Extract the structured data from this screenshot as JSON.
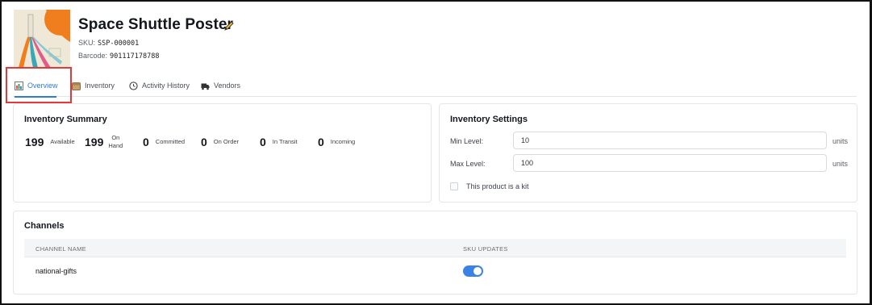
{
  "product": {
    "title": "Space Shuttle Poster",
    "sku_label": "SKU:",
    "sku_value": "SSP-000001",
    "barcode_label": "Barcode:",
    "barcode_value": "901117178788"
  },
  "tabs": [
    {
      "label": "Overview",
      "icon": "chart-icon",
      "active": true
    },
    {
      "label": "Inventory",
      "icon": "box-icon",
      "active": false
    },
    {
      "label": "Activity History",
      "icon": "clock-icon",
      "active": false
    },
    {
      "label": "Vendors",
      "icon": "truck-icon",
      "active": false
    }
  ],
  "inventory_summary": {
    "title": "Inventory Summary",
    "stats": [
      {
        "value": "199",
        "label": "Available"
      },
      {
        "value": "199",
        "label": "On Hand"
      },
      {
        "value": "0",
        "label": "Committed"
      },
      {
        "value": "0",
        "label": "On Order"
      },
      {
        "value": "0",
        "label": "In Transit"
      },
      {
        "value": "0",
        "label": "Incoming"
      }
    ]
  },
  "inventory_settings": {
    "title": "Inventory Settings",
    "min_label": "Min Level:",
    "min_value": "10",
    "max_label": "Max Level:",
    "max_value": "100",
    "unit": "units",
    "kit_label": "This product is a kit",
    "kit_checked": false
  },
  "channels": {
    "title": "Channels",
    "columns": [
      "CHANNEL NAME",
      "SKU UPDATES"
    ],
    "rows": [
      {
        "name": "national-gifts",
        "sku_updates": true
      }
    ]
  },
  "colors": {
    "accent": "#2f7bd8",
    "toggle_on": "#3b82e6",
    "highlight": "#e03a3a",
    "poster_orange": "#f07d1e"
  }
}
